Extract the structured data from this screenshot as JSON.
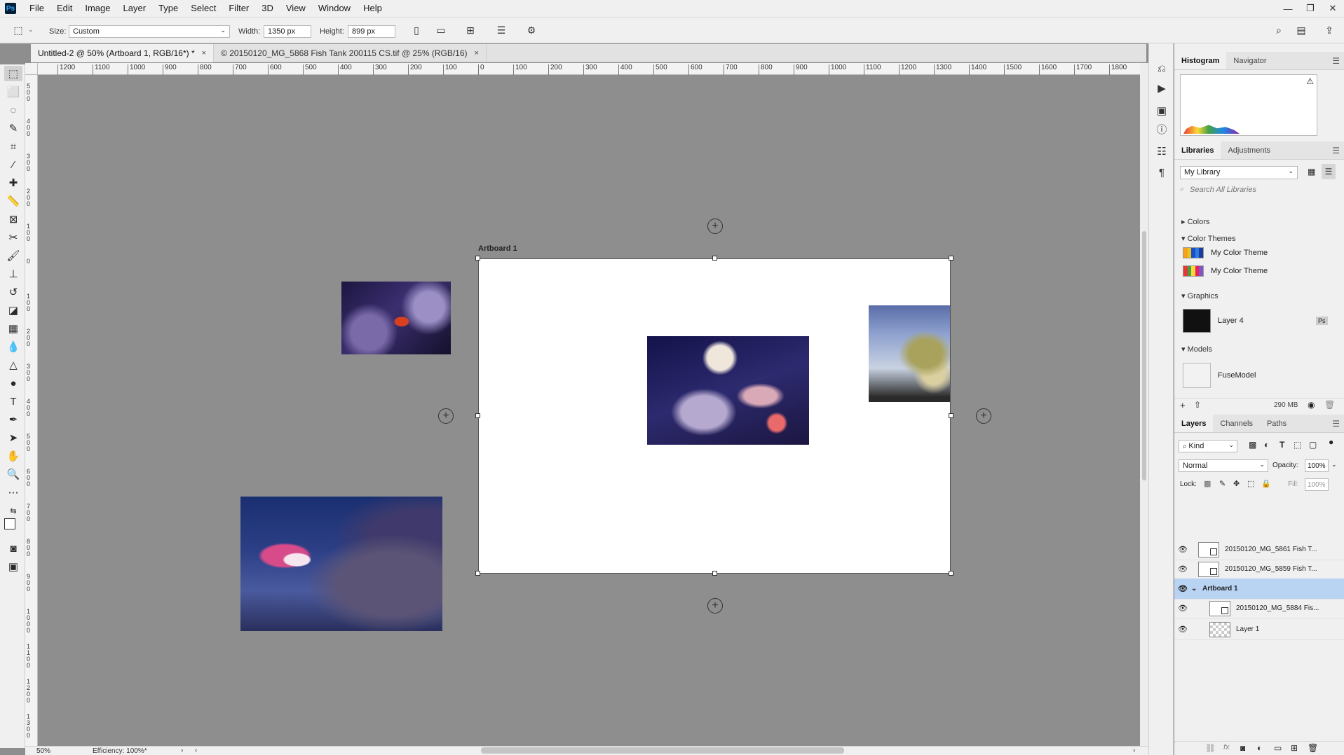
{
  "app": {
    "logo": "Ps"
  },
  "menu": [
    "File",
    "Edit",
    "Image",
    "Layer",
    "Type",
    "Select",
    "Filter",
    "3D",
    "View",
    "Window",
    "Help"
  ],
  "window_controls": {
    "minimize": "—",
    "restore": "❐",
    "close": "✕"
  },
  "options_bar": {
    "size_label": "Size:",
    "size_value": "Custom",
    "width_label": "Width:",
    "width_value": "1350 px",
    "height_label": "Height:",
    "height_value": "899 px"
  },
  "tabs": [
    {
      "label": "Untitled-2 @ 50% (Artboard 1, RGB/16*) *",
      "close": "×"
    },
    {
      "label": "© 20150120_MG_5868 Fish Tank 200115 CS.tif @ 25% (RGB/16)",
      "close": "×"
    }
  ],
  "ruler": {
    "h_ticks": [
      "1200",
      "1100",
      "1000",
      "900",
      "800",
      "700",
      "600",
      "500",
      "400",
      "300",
      "200",
      "100",
      "0",
      "100",
      "200",
      "300",
      "400",
      "500",
      "600",
      "700",
      "800",
      "900",
      "1000",
      "1100",
      "1200",
      "1300",
      "1400",
      "1500",
      "1600",
      "1700",
      "1800"
    ],
    "v_ticks": [
      "5 0 0",
      "4 0 0",
      "3 0 0",
      "2 0 0",
      "1 0 0",
      "0",
      "1 0 0",
      "2 0 0",
      "3 0 0",
      "4 0 0",
      "5 0 0",
      "6 0 0",
      "7 0 0",
      "8 0 0",
      "9 0 0",
      "1 0 0 0",
      "1 1 0 0",
      "1 2 0 0",
      "1 3 0 0"
    ]
  },
  "canvas": {
    "artboard_label": "Artboard 1",
    "photo_names": [
      "fish-photo-red-hawkfish",
      "fish-photo-firefish",
      "coral-photo-center",
      "anemone-photo-right"
    ]
  },
  "status": {
    "zoom": "50%",
    "info": "Efficiency: 100%*",
    "arrow": "›",
    "left_arrow": "‹",
    "right_arrow": "›"
  },
  "panels": {
    "histogram": {
      "tabs": [
        "Histogram",
        "Navigator"
      ],
      "warning": "⚠"
    },
    "libraries": {
      "tabs": [
        "Libraries",
        "Adjustments"
      ],
      "library_select": "My Library",
      "search_placeholder": "Search All Libraries",
      "sections": {
        "colors": "Colors",
        "color_themes": "Color Themes",
        "graphics": "Graphics",
        "models": "Models"
      },
      "themes": [
        {
          "label": "My Color Theme",
          "colors": [
            "#f4a21b",
            "#e8c21e",
            "#1c4ec9",
            "#2d7ee0",
            "#1b3c9e"
          ]
        },
        {
          "label": "My Color Theme",
          "colors": [
            "#e53935",
            "#43a047",
            "#fdd835",
            "#e91e63",
            "#7e57c2"
          ]
        }
      ],
      "graphic": {
        "label": "Layer 4",
        "badge": "Ps"
      },
      "model": {
        "label": "FuseModel"
      },
      "storage": "290 MB"
    },
    "layers": {
      "tabs": [
        "Layers",
        "Channels",
        "Paths"
      ],
      "kind_filter": "Kind",
      "blend_mode": "Normal",
      "opacity_label": "Opacity:",
      "opacity_value": "100%",
      "lock_label": "Lock:",
      "fill_label": "Fill:",
      "fill_value": "100%",
      "rows": [
        {
          "name": "20150120_MG_5861 Fish T...",
          "type": "smart",
          "indent": 0,
          "selected": false
        },
        {
          "name": "20150120_MG_5859 Fish T...",
          "type": "smart",
          "indent": 0,
          "selected": false
        },
        {
          "name": "Artboard 1",
          "type": "artboard",
          "indent": 0,
          "selected": true
        },
        {
          "name": "20150120_MG_5884 Fis...",
          "type": "smart",
          "indent": 1,
          "selected": false
        },
        {
          "name": "Layer 1",
          "type": "transparent",
          "indent": 1,
          "selected": false
        }
      ]
    }
  },
  "colors": {
    "accent": "#31a8ff",
    "selection": "#b9d3f3",
    "canvas_bg": "#8e8e8e"
  }
}
